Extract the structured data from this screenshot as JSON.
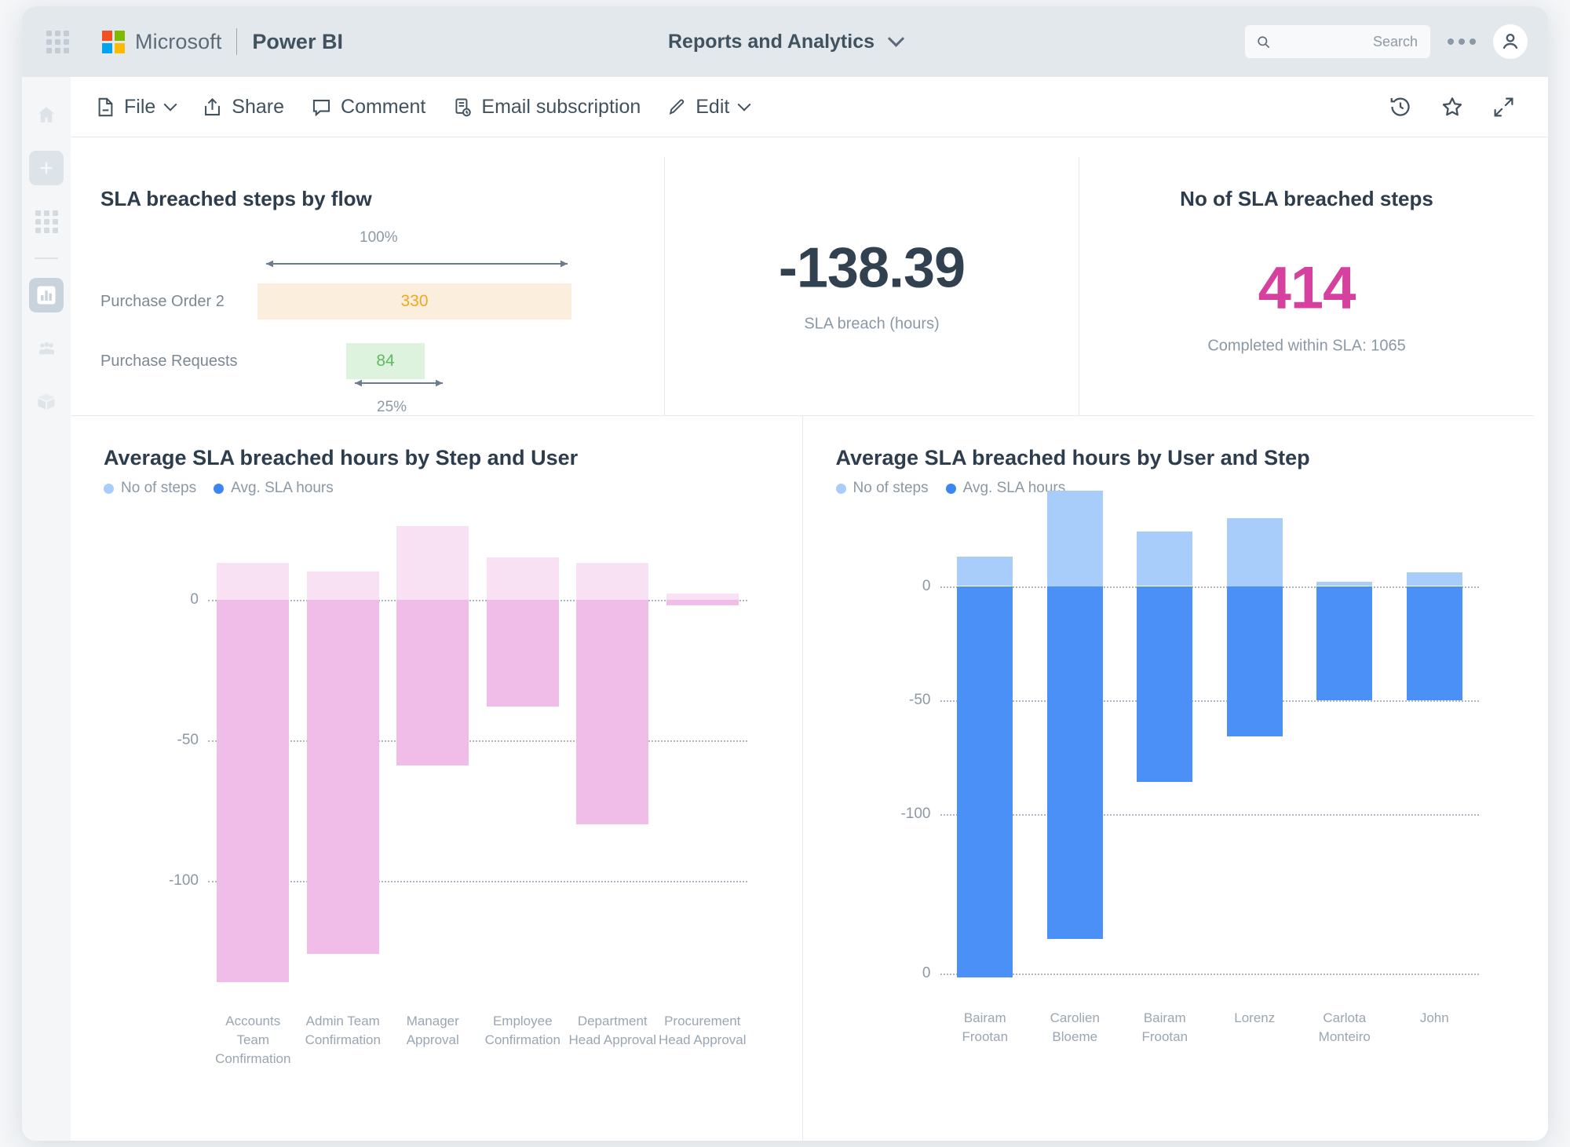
{
  "topbar": {
    "waffle_icon": "waffle-grid-icon",
    "brand": "Microsoft",
    "product": "Power BI",
    "report_title": "Reports and Analytics",
    "title_chevron_icon": "chevron-down-icon",
    "search": {
      "placeholder": "Search",
      "icon": "search-icon"
    },
    "more_icon": "ellipsis-icon",
    "account_icon": "account-avatar-icon"
  },
  "rail": {
    "items": [
      {
        "name": "home",
        "icon": "home-icon"
      },
      {
        "name": "create",
        "icon": "plus-icon"
      },
      {
        "name": "apps",
        "icon": "grid-apps-icon"
      },
      {
        "name": "reports",
        "icon": "bar-chart-icon",
        "selected": true
      },
      {
        "name": "teams",
        "icon": "people-icon"
      },
      {
        "name": "deploy",
        "icon": "box-icon"
      }
    ]
  },
  "commandbar": {
    "items": [
      {
        "label": "File",
        "icon": "file-icon",
        "chevron": true
      },
      {
        "label": "Share",
        "icon": "share-icon",
        "chevron": false
      },
      {
        "label": "Comment",
        "icon": "comment-icon",
        "chevron": false
      },
      {
        "label": "Email subscription",
        "icon": "email-subscription-icon",
        "chevron": false
      },
      {
        "label": "Edit",
        "icon": "pencil-icon",
        "chevron": true
      }
    ],
    "right_icons": [
      {
        "name": "history-icon"
      },
      {
        "name": "favorite-star-icon"
      },
      {
        "name": "fullscreen-icon"
      }
    ]
  },
  "cards": {
    "flow": {
      "title": "SLA breached steps by flow",
      "top_percent": "100%",
      "bottom_percent": "25%",
      "rows": [
        {
          "label": "Purchase Order 2",
          "value": "330",
          "ratio": 1.0,
          "style": "orange"
        },
        {
          "label": "Purchase Requests",
          "value": "84",
          "ratio": 0.25,
          "style": "green"
        }
      ]
    },
    "sla_breach": {
      "value": "-138.39",
      "sublabel": "SLA breach (hours)"
    },
    "breached_steps": {
      "title": "No of SLA breached steps",
      "value": "414",
      "sublabel": "Completed within SLA: 1065",
      "accent": "#d6409f"
    }
  },
  "chart_data": [
    {
      "id": "step_user",
      "type": "bar",
      "title": "Average SLA breached hours by Step and User",
      "legend": [
        {
          "name": "No of steps",
          "color": "#a9cdfb"
        },
        {
          "name": "Avg. SLA hours",
          "color": "#3b86f3"
        }
      ],
      "legend_position": "top-left",
      "grid": true,
      "xlabel": "",
      "ylabel": "",
      "yticks": [
        0,
        -50,
        -100
      ],
      "ytick_labels": [
        "0",
        "-50",
        "-100"
      ],
      "ylim": [
        -145,
        25
      ],
      "palette": {
        "light": "#f8e1f3",
        "dark": "#f0bde8"
      },
      "categories": [
        "Accounts Team Confirmation",
        "Admin Team Confirmation",
        "Manager Approval",
        "Employee Confirmation",
        "Department Head Approval",
        "Procurement Head Approval"
      ],
      "series": [
        {
          "name": "No of steps",
          "values": [
            13,
            10,
            26,
            15,
            13,
            2
          ]
        },
        {
          "name": "Avg. SLA hours",
          "values": [
            -136,
            -126,
            -59,
            -38,
            -80,
            -2
          ]
        }
      ]
    },
    {
      "id": "user_step",
      "type": "bar",
      "title": "Average SLA breached hours by User and Step",
      "legend": [
        {
          "name": "No of steps",
          "color": "#a9cdfb"
        },
        {
          "name": "Avg. SLA hours",
          "color": "#3b86f3"
        }
      ],
      "legend_position": "top-left",
      "grid": true,
      "xlabel": "",
      "ylabel": "",
      "yticks": [
        0,
        -50,
        -100,
        -170
      ],
      "ytick_labels": [
        "0",
        "-50",
        "-100",
        "0"
      ],
      "ylim": [
        -185,
        25
      ],
      "palette": {
        "light": "#a9cdfb",
        "dark": "#4a90f7"
      },
      "categories": [
        "Bairam Frootan",
        "Carolien Bloeme",
        "Carolien Bloeme",
        "Lorenz",
        "Carlota Monteiro",
        "John"
      ],
      "visible_categories": [
        "Bairam Frootan",
        "Carolien Bloeme",
        "Bairam Frootan",
        "Lorenz",
        "Carlota Monteiro",
        "John"
      ],
      "series": [
        {
          "name": "No of steps",
          "values": [
            13,
            42,
            24,
            30,
            2,
            6
          ]
        },
        {
          "name": "Avg. SLA hours",
          "values": [
            -172,
            -155,
            -86,
            -66,
            -50,
            -50
          ]
        }
      ]
    }
  ]
}
